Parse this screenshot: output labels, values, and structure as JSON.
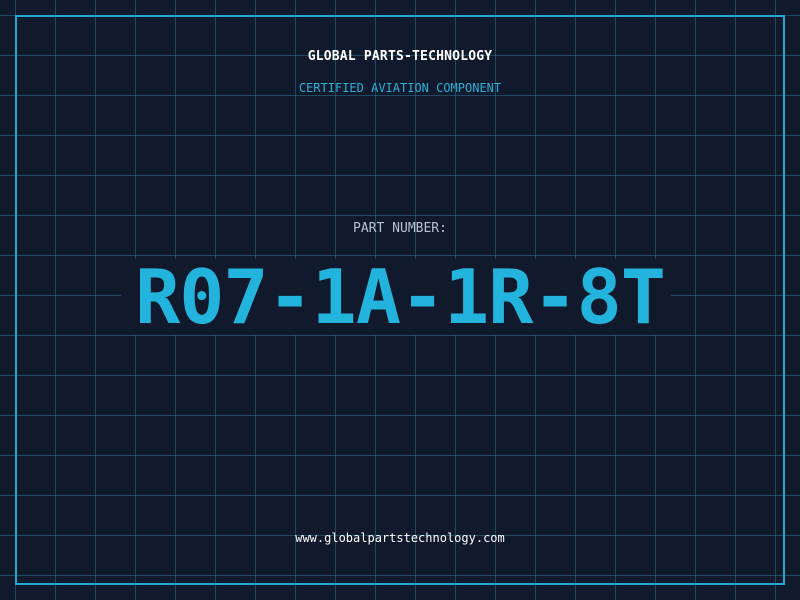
{
  "header": {
    "company": "GLOBAL PARTS-TECHNOLOGY",
    "subtitle": "CERTIFIED AVIATION COMPONENT"
  },
  "part": {
    "label": "PART NUMBER:",
    "number": "R07-1A-1R-8T"
  },
  "footer": {
    "website": "www.globalpartstechnology.com"
  },
  "colors": {
    "background": "#111a2c",
    "grid": "#2d6e8c",
    "accent": "#22b4dc",
    "text": "#ffffff",
    "muted": "#b9c2cf"
  }
}
